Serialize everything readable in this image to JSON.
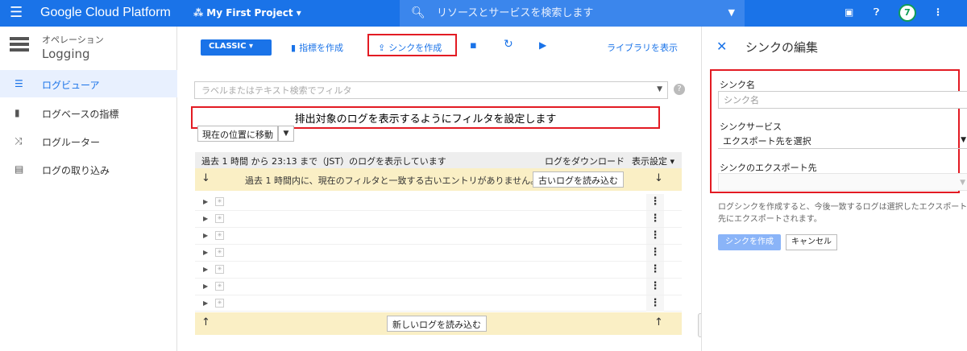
{
  "topbar": {
    "brand": "Google Cloud Platform",
    "project": "My First Project",
    "search_placeholder": "リソースとサービスを検索します",
    "avatar": "7"
  },
  "sidebar": {
    "section_sup": "オペレーション",
    "section_title": "Logging",
    "items": [
      {
        "label": "ログビューア",
        "icon": "list-icon"
      },
      {
        "label": "ログベースの指標",
        "icon": "bar-chart-icon"
      },
      {
        "label": "ログルーター",
        "icon": "shuffle-icon"
      },
      {
        "label": "ログの取り込み",
        "icon": "storage-icon"
      }
    ]
  },
  "toolbar": {
    "classic": "CLASSIC",
    "create_metric": "指標を作成",
    "create_sink": "シンクを作成",
    "library": "ライブラリを表示"
  },
  "filter": {
    "placeholder": "ラベルまたはテキスト検索でフィルタ"
  },
  "annotation": "排出対象のログを表示するようにフィルタを設定します",
  "goto_label": "現在の位置に移動",
  "logs": {
    "header": "過去 1 時間 から 23:13 まで（JST）のログを表示しています",
    "download": "ログをダウンロード",
    "display_settings": "表示設定",
    "old_msg": "過去 1 時間内に、現在のフィルタと一致する古いエントリがありません。",
    "load_old": "古いログを読み込む",
    "load_new": "新しいログを読み込む"
  },
  "panel": {
    "title": "シンクの編集",
    "sink_name_label": "シンク名",
    "sink_name_placeholder": "シンク名",
    "sink_service_label": "シンクサービス",
    "sink_service_value": "エクスポート先を選択",
    "sink_dest_label": "シンクのエクスポート先",
    "sink_dest_value": "",
    "description": "ログシンクを作成すると、今後一致するログは選択したエクスポート先にエクスポートされます。",
    "create": "シンクを作成",
    "cancel": "キャンセル"
  },
  "colors": {
    "primary": "#1a73e8",
    "highlight": "#e31b23",
    "banner": "#faefc5"
  }
}
